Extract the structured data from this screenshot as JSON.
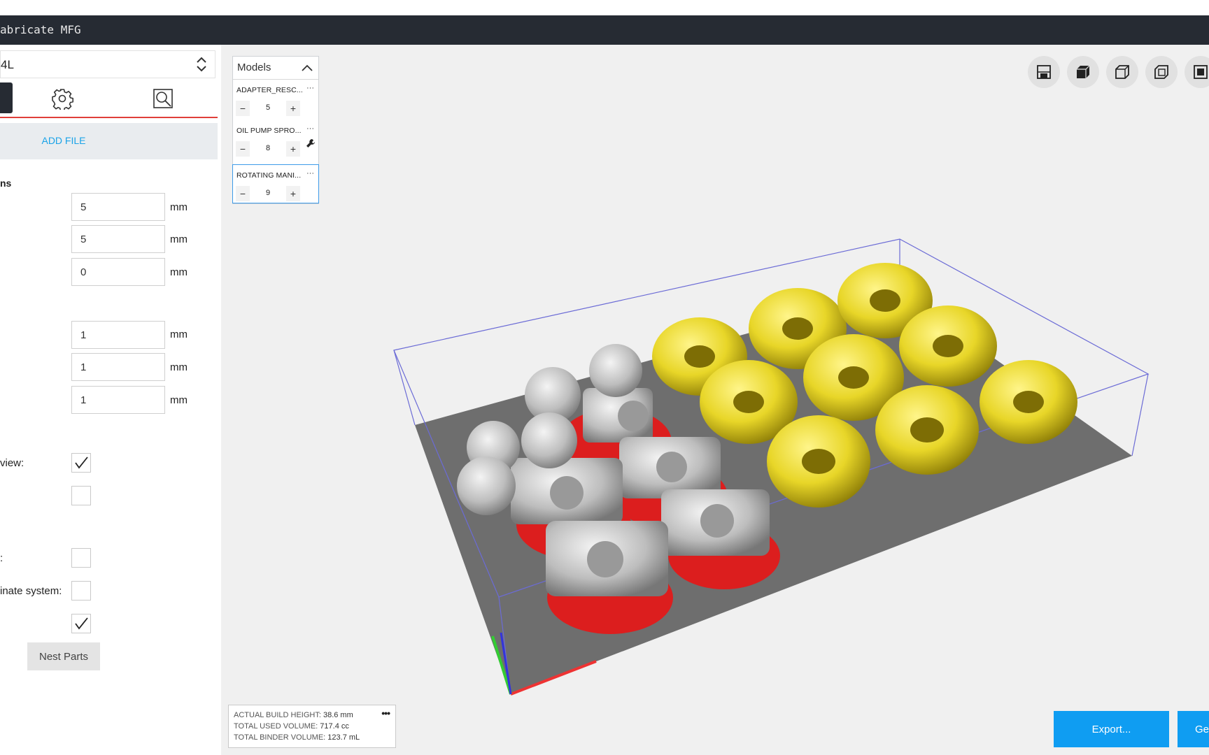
{
  "app": {
    "title": "abricate MFG"
  },
  "printer": {
    "selected": "4L"
  },
  "tabs": [
    {
      "name": "layout",
      "icon": "layout-tab-icon"
    },
    {
      "name": "settings",
      "icon": "gear-icon"
    },
    {
      "name": "inspect",
      "icon": "magnify-icon"
    }
  ],
  "add_file": {
    "label": "ADD FILE"
  },
  "spacing": {
    "section_label": "ns",
    "fields": [
      {
        "value": "5",
        "unit": "mm"
      },
      {
        "value": "5",
        "unit": "mm"
      },
      {
        "value": "0",
        "unit": "mm"
      }
    ]
  },
  "margins": {
    "fields": [
      {
        "value": "1",
        "unit": "mm"
      },
      {
        "value": "1",
        "unit": "mm"
      },
      {
        "value": "1",
        "unit": "mm"
      }
    ]
  },
  "options": [
    {
      "label": "view:",
      "checked": true
    },
    {
      "label": "",
      "checked": false
    },
    {
      "label": ":",
      "checked": false
    },
    {
      "label": "inate system:",
      "checked": false
    },
    {
      "label": "",
      "checked": true
    }
  ],
  "nest_button": {
    "label": "Nest Parts"
  },
  "models_panel": {
    "title": "Models",
    "items": [
      {
        "name": "ADAPTER_RESC...",
        "qty": "5"
      },
      {
        "name": "OIL PUMP SPRO...",
        "qty": "8"
      },
      {
        "name": "ROTATING MANI...",
        "qty": "9"
      }
    ],
    "menu_glyph": "···",
    "minus": "−",
    "plus": "+"
  },
  "view_buttons": [
    "front-view-icon",
    "iso-view-icon",
    "side-view-icon",
    "back-view-icon",
    "top-view-icon"
  ],
  "stats": {
    "rows": [
      {
        "key": "ACTUAL BUILD HEIGHT:",
        "value": "38.6 mm"
      },
      {
        "key": "TOTAL USED VOLUME:",
        "value": "717.4 cc"
      },
      {
        "key": "TOTAL BINDER VOLUME:",
        "value": "123.7 mL"
      }
    ],
    "menu_glyph": "•••"
  },
  "buttons": {
    "export": "Export...",
    "generate": "Ge"
  },
  "colors": {
    "accent_blue": "#0f9df2",
    "tab_red": "#e0403a",
    "titlebar": "#262b33",
    "part_yellow": "#e8d628",
    "part_grey": "#c4c4c4",
    "part_red": "#dc1e1e",
    "bed_grey": "#6e6e6e",
    "bbox_line": "#6b6bd6"
  }
}
